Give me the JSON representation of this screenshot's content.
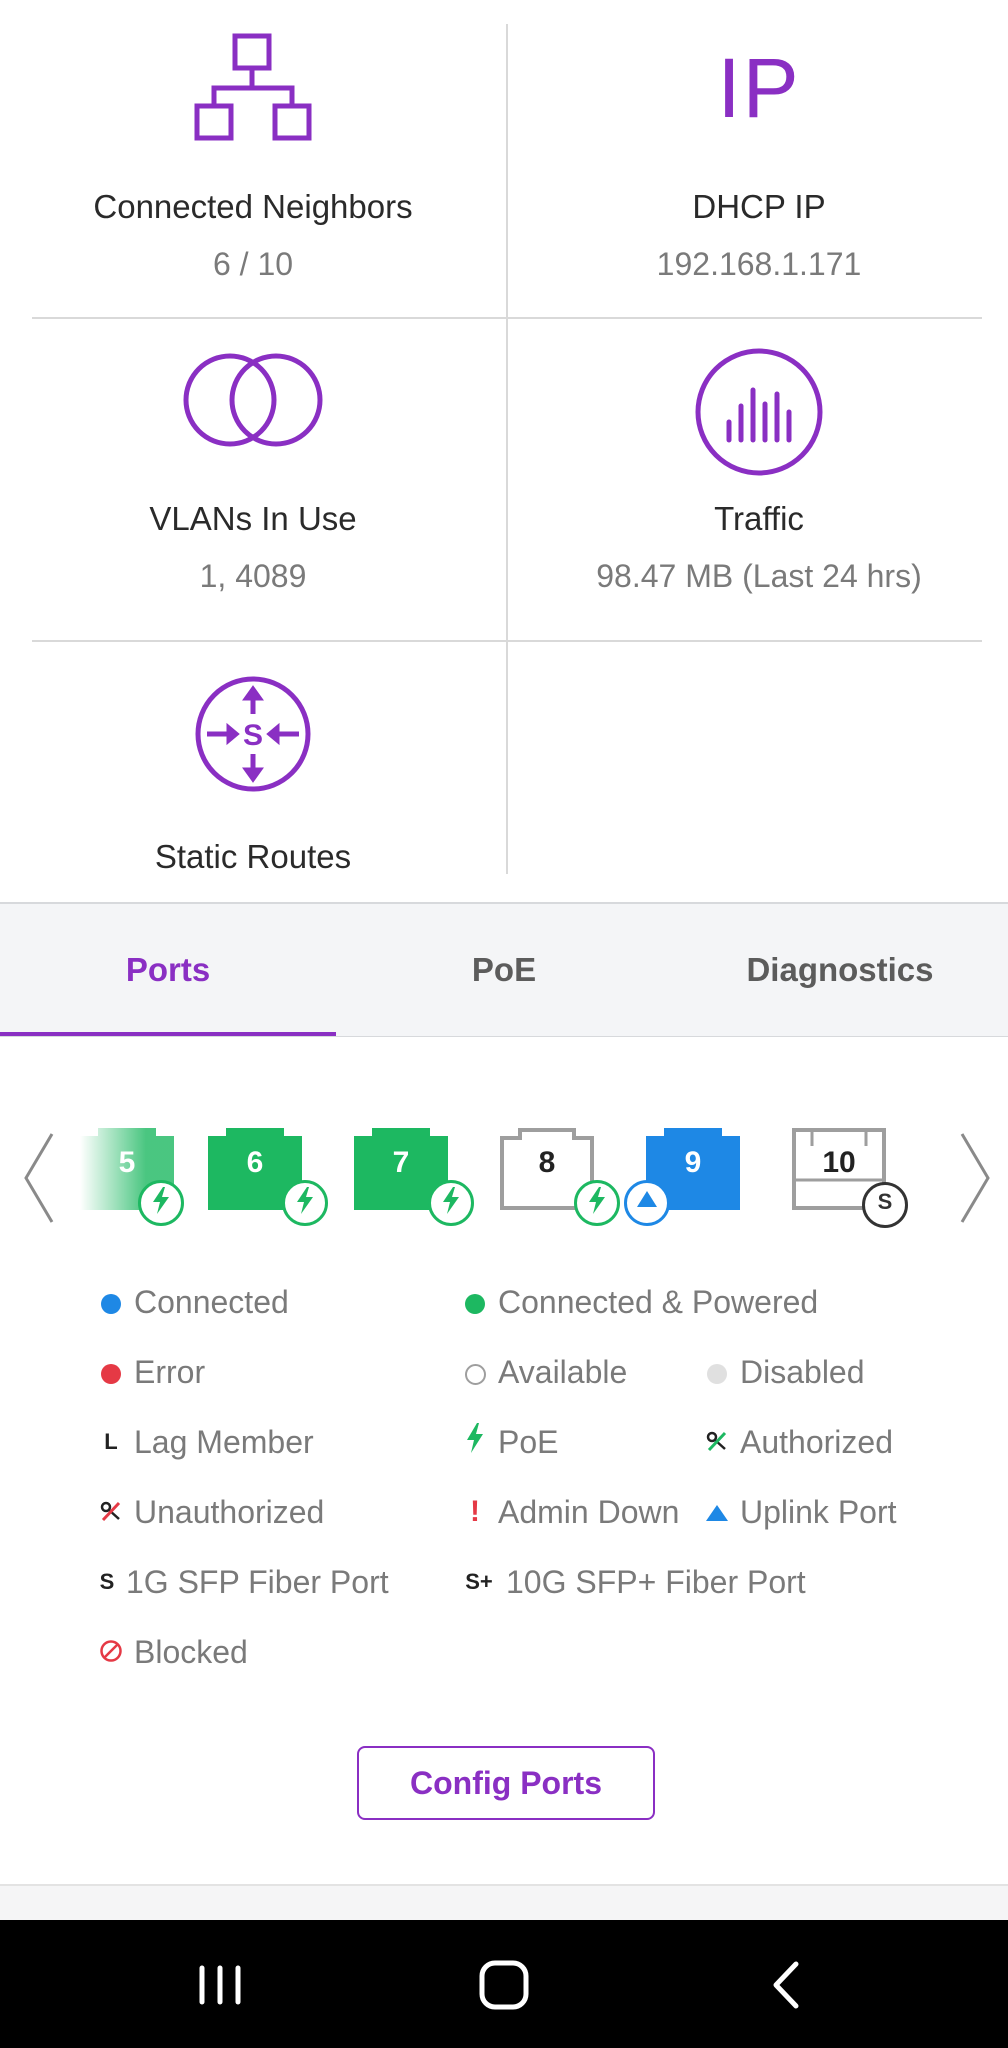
{
  "stats": {
    "neighbors": {
      "label": "Connected Neighbors",
      "value": "6 / 10",
      "icon": "network-topology-icon"
    },
    "dhcp": {
      "icon_text": "IP",
      "label": "DHCP IP",
      "value": "192.168.1.171"
    },
    "vlans": {
      "label": "VLANs In Use",
      "value": "1, 4089",
      "icon": "overlapping-circles-icon"
    },
    "traffic": {
      "label": "Traffic",
      "value": "98.47 MB (Last 24 hrs)",
      "icon": "bar-circle-icon"
    },
    "routes": {
      "label": "Static Routes",
      "icon_text": "S",
      "icon": "route-arrows-icon"
    }
  },
  "tabs": [
    {
      "label": "Ports",
      "active": true
    },
    {
      "label": "PoE",
      "active": false
    },
    {
      "label": "Diagnostics",
      "active": false
    }
  ],
  "ports": [
    {
      "number": "5",
      "state": "connected-powered",
      "badge": "poe"
    },
    {
      "number": "6",
      "state": "connected-powered",
      "badge": "poe"
    },
    {
      "number": "7",
      "state": "connected-powered",
      "badge": "poe"
    },
    {
      "number": "8",
      "state": "available",
      "badge": "poe"
    },
    {
      "number": "9",
      "state": "connected",
      "badge": "uplink"
    },
    {
      "number": "10",
      "state": "available",
      "badge": "sfp",
      "badge_text": "S"
    }
  ],
  "legend": {
    "connected": "Connected",
    "connected_powered": "Connected & Powered",
    "error": "Error",
    "available": "Available",
    "disabled": "Disabled",
    "lag": {
      "marker": "L",
      "label": "Lag Member"
    },
    "poe": "PoE",
    "authorized": "Authorized",
    "unauthorized": "Unauthorized",
    "admin_down": {
      "marker": "!",
      "label": "Admin Down"
    },
    "uplink": "Uplink Port",
    "sfp": {
      "marker": "S",
      "label": "1G SFP Fiber Port"
    },
    "sfp_plus": {
      "marker": "S+",
      "label": "10G SFP+ Fiber Port"
    },
    "blocked": "Blocked"
  },
  "config_button": "Config Ports",
  "colors": {
    "accent": "#8a2fc3",
    "connected": "#1e88e5",
    "powered": "#1db861",
    "error": "#e53945",
    "available": "#9e9e9e",
    "disabled": "#e0e0e0"
  },
  "navbar": {
    "recent": "recent-apps-icon",
    "home": "home-icon",
    "back": "back-icon"
  }
}
